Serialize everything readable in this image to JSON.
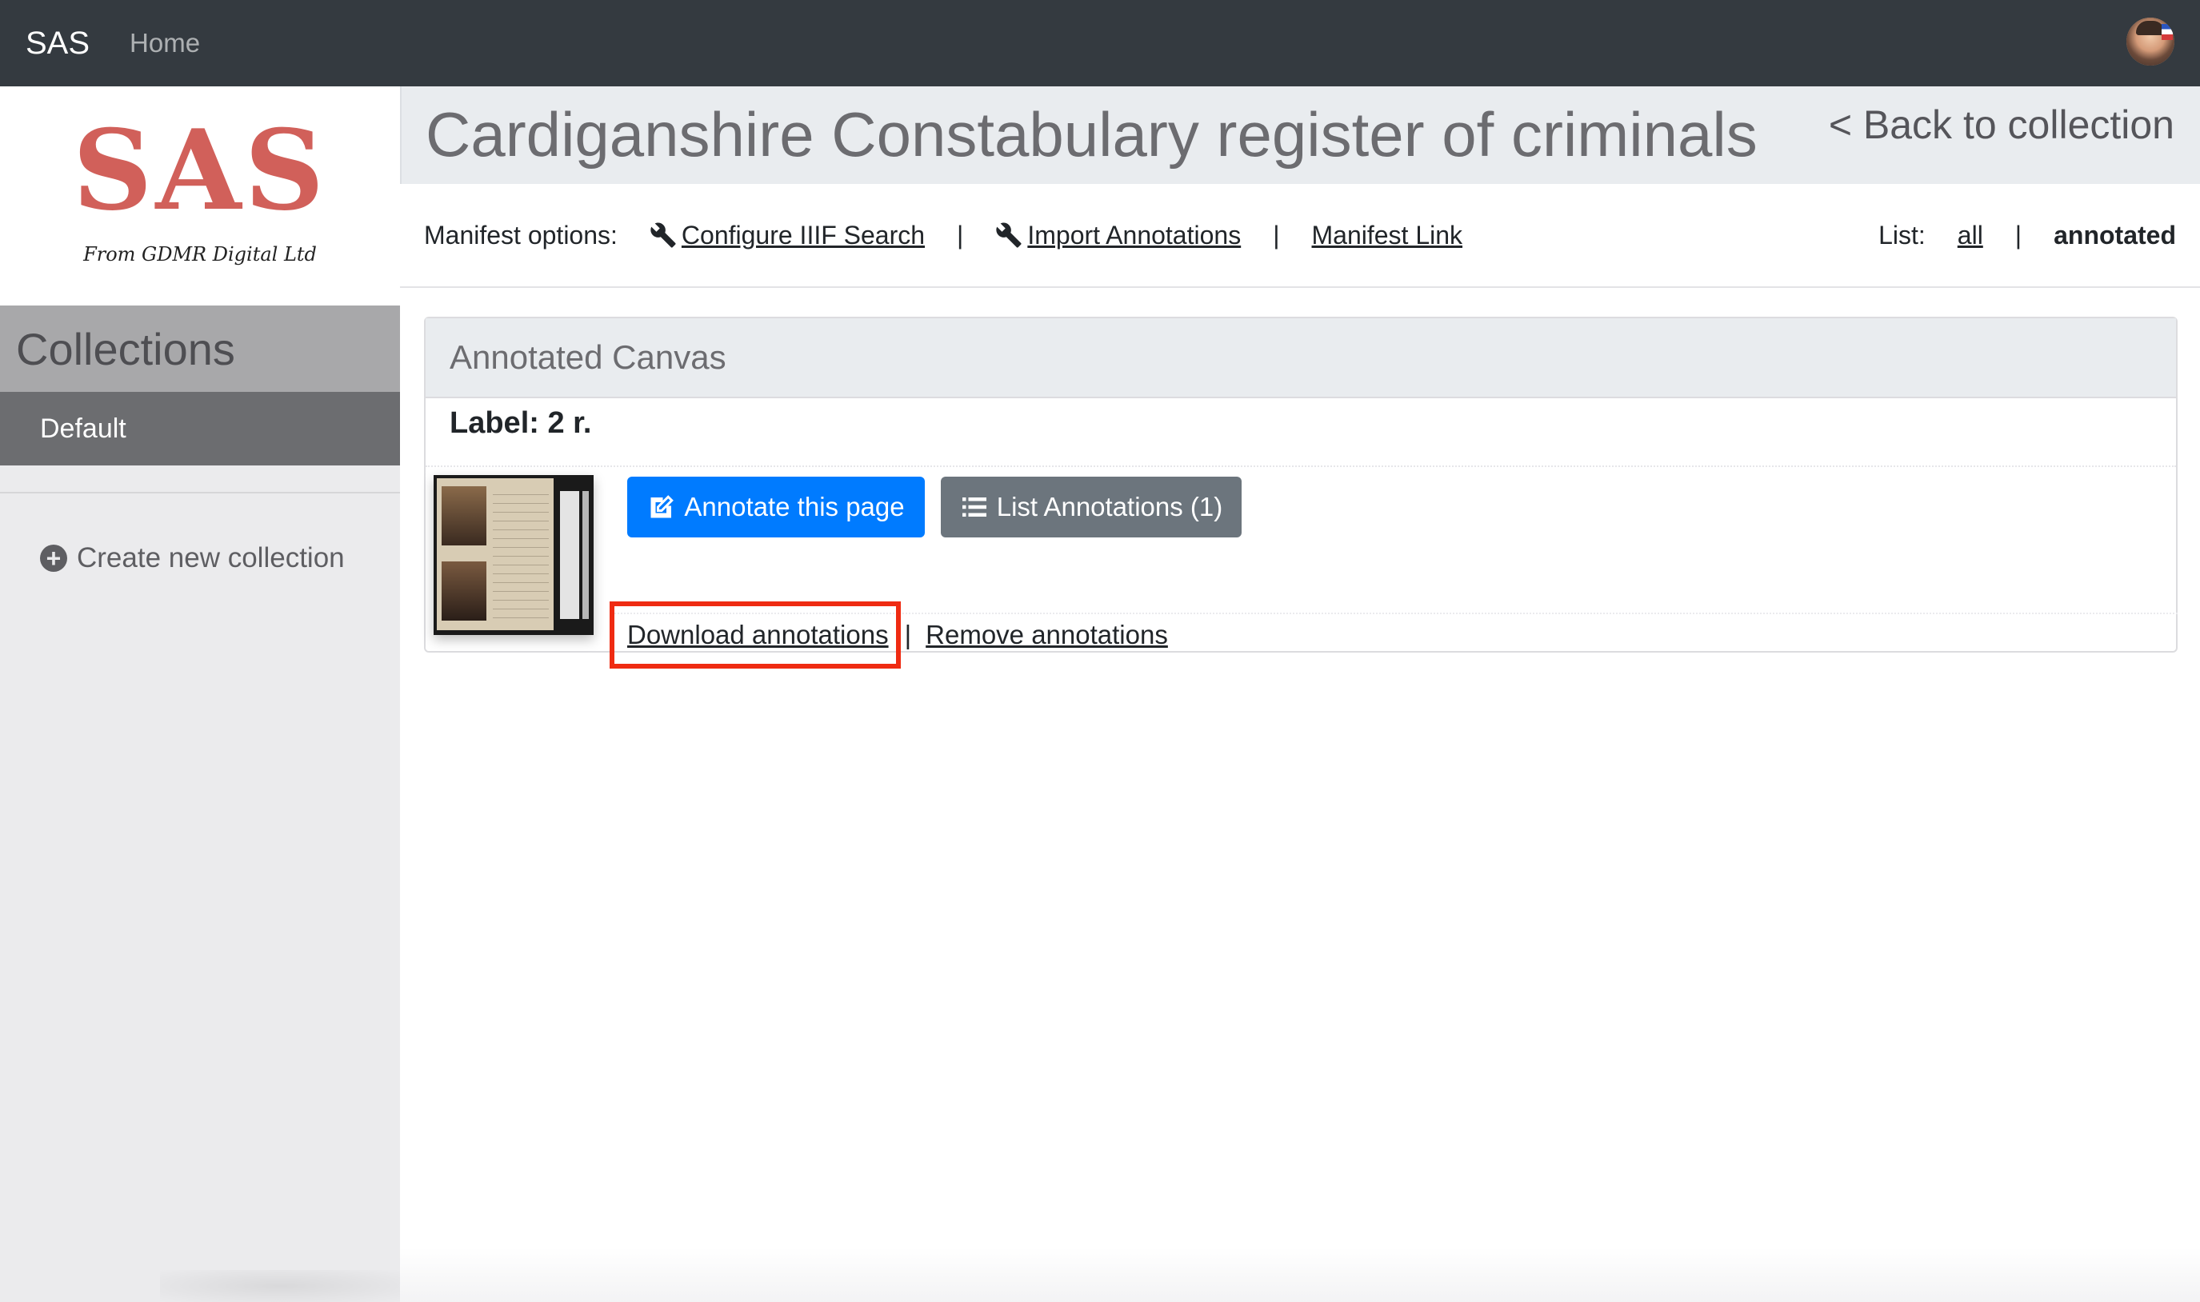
{
  "navbar": {
    "brand": "SAS",
    "home": "Home",
    "avatar_icon": "user-avatar"
  },
  "sidebar": {
    "logo_text": "SAS",
    "logo_subtitle": "From GDMR Digital Ltd",
    "collections_title": "Collections",
    "collections": [
      {
        "label": "Default",
        "active": true
      }
    ],
    "create_new_label": "Create new collection",
    "create_new_icon": "plus-circle-icon"
  },
  "header": {
    "title": "Cardiganshire Constabulary register of criminals",
    "back_link": "< Back to collection"
  },
  "manifest_options": {
    "label": "Manifest options:",
    "configure_search": "Configure IIIF Search",
    "import_annotations": "Import Annotations",
    "manifest_link": "Manifest Link",
    "separator": "|",
    "list_label": "List:",
    "list_all": "all",
    "list_annotated": "annotated",
    "list_active": "annotated"
  },
  "canvas_card": {
    "header": "Annotated Canvas",
    "label_text": "Label: 2 r.",
    "annotate_button": "Annotate this page",
    "list_button": "List Annotations (1)",
    "download_link": "Download annotations",
    "remove_link": "Remove annotations",
    "separator": "|"
  },
  "colors": {
    "navbar_bg": "#343a40",
    "primary": "#007bff",
    "secondary": "#6c757d",
    "logo_red": "#d1605a",
    "highlight": "#ef2b12"
  }
}
